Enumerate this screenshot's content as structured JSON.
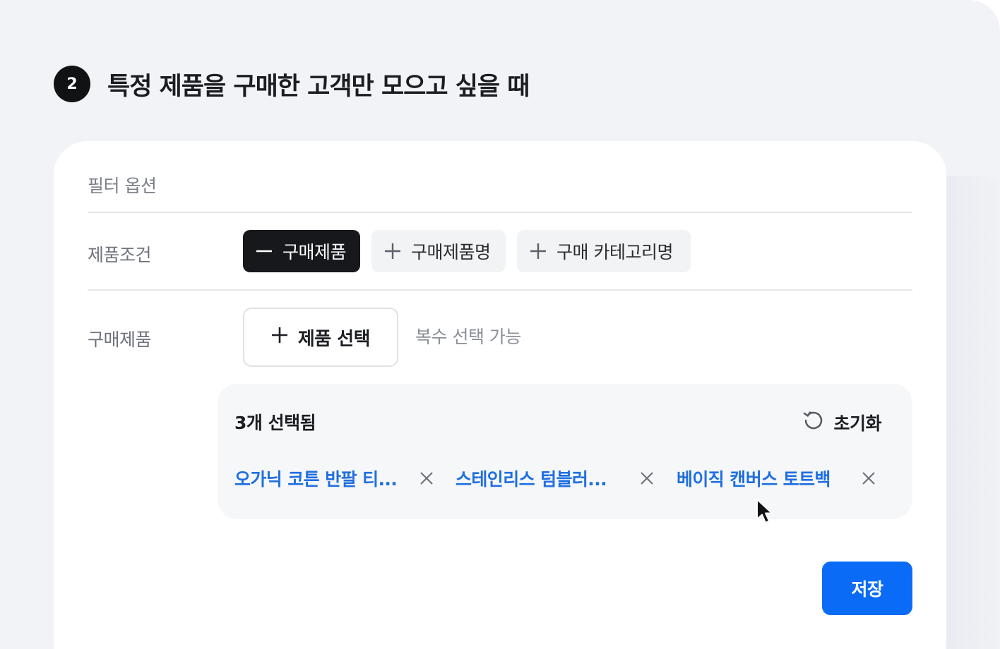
{
  "step": {
    "number": "2",
    "title": "특정 제품을 구매한 고객만 모으고 싶을 때"
  },
  "filter": {
    "section_label": "필터 옵션",
    "product_condition_label": "제품조건",
    "chips": [
      {
        "label": "구매제품",
        "state": "active",
        "icon": "minus-icon"
      },
      {
        "label": "구매제품명",
        "state": "inactive",
        "icon": "plus-icon"
      },
      {
        "label": "구매 카테고리명",
        "state": "inactive",
        "icon": "plus-icon"
      }
    ],
    "purchase_product_label": "구매제품",
    "select_button_label": "제품 선택",
    "helper_text": "복수 선택 가능"
  },
  "selection": {
    "count_text": "3개 선택됨",
    "reset_label": "초기화",
    "tags": [
      {
        "label": "오가닉 코튼 반팔 티..."
      },
      {
        "label": "스테인리스 텀블러..."
      },
      {
        "label": "베이직 캔버스 토트백"
      }
    ]
  },
  "actions": {
    "save_label": "저장"
  },
  "colors": {
    "accent": "#0A6CF6",
    "tag_text": "#1F6FE0",
    "active_chip": "#17181C",
    "background": "#F2F3F6"
  }
}
